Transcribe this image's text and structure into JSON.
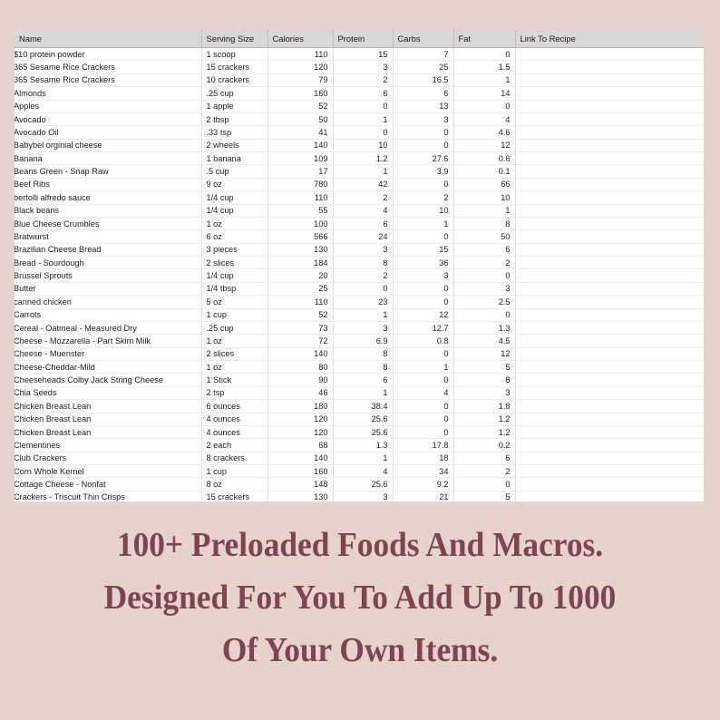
{
  "theme": {
    "background": "#e8d2cc",
    "headline_color": "#7d4552",
    "header_row_bg": "#d8d8d8",
    "cell_bg": "#ffffff",
    "grid_line": "#e0e0e0"
  },
  "spreadsheet": {
    "columns": [
      "Name",
      "Serving Size",
      "Calories",
      "Protein",
      "Carbs",
      "Fat",
      "Link To Recipe"
    ],
    "rows": [
      {
        "name": "$10 protein powder",
        "serving": "1 scoop",
        "calories": "110",
        "protein": "15",
        "carbs": "7",
        "fat": "0",
        "link": ""
      },
      {
        "name": "365 Sesame Rice Crackers",
        "serving": "15 crackers",
        "calories": "120",
        "protein": "3",
        "carbs": "25",
        "fat": "1.5",
        "link": ""
      },
      {
        "name": "365 Sesame Rice Crackers",
        "serving": "10 crackers",
        "calories": "79",
        "protein": "2",
        "carbs": "16.5",
        "fat": "1",
        "link": ""
      },
      {
        "name": "Almonds",
        "serving": ".25 cup",
        "calories": "160",
        "protein": "6",
        "carbs": "6",
        "fat": "14",
        "link": ""
      },
      {
        "name": "Apples",
        "serving": "1 apple",
        "calories": "52",
        "protein": "0",
        "carbs": "13",
        "fat": "0",
        "link": ""
      },
      {
        "name": "Avocado",
        "serving": "2 tbsp",
        "calories": "50",
        "protein": "1",
        "carbs": "3",
        "fat": "4",
        "link": ""
      },
      {
        "name": "Avocado Oil",
        "serving": ".33 tsp",
        "calories": "41",
        "protein": "0",
        "carbs": "0",
        "fat": "4.6",
        "link": ""
      },
      {
        "name": "Babybel orginial cheese",
        "serving": "2 wheels",
        "calories": "140",
        "protein": "10",
        "carbs": "0",
        "fat": "12",
        "link": ""
      },
      {
        "name": "Banana",
        "serving": "1 banana",
        "calories": "109",
        "protein": "1.2",
        "carbs": "27.6",
        "fat": "0.6",
        "link": ""
      },
      {
        "name": "Beans Green - Snap Raw",
        "serving": ".5 cup",
        "calories": "17",
        "protein": "1",
        "carbs": "3.9",
        "fat": "0.1",
        "link": ""
      },
      {
        "name": "Beef Ribs",
        "serving": "9 oz",
        "calories": "780",
        "protein": "42",
        "carbs": "0",
        "fat": "66",
        "link": ""
      },
      {
        "name": "bertolli alfredo sauce",
        "serving": "1/4 cup",
        "calories": "110",
        "protein": "2",
        "carbs": "2",
        "fat": "10",
        "link": ""
      },
      {
        "name": "Black beans",
        "serving": "1/4 cup",
        "calories": "55",
        "protein": "4",
        "carbs": "10",
        "fat": "1",
        "link": ""
      },
      {
        "name": "Blue Cheese Crumbles",
        "serving": "1 oz",
        "calories": "100",
        "protein": "6",
        "carbs": "1",
        "fat": "8",
        "link": ""
      },
      {
        "name": "Bratwurst",
        "serving": "6 oz",
        "calories": "566",
        "protein": "24",
        "carbs": "0",
        "fat": "50",
        "link": ""
      },
      {
        "name": "Brazilian Cheese Bread",
        "serving": "3 pieces",
        "calories": "130",
        "protein": "3",
        "carbs": "15",
        "fat": "6",
        "link": ""
      },
      {
        "name": "Bread - Sourdough",
        "serving": "2 slices",
        "calories": "184",
        "protein": "8",
        "carbs": "36",
        "fat": "2",
        "link": ""
      },
      {
        "name": "Brussel Sprouts",
        "serving": "1/4 cup",
        "calories": "20",
        "protein": "2",
        "carbs": "3",
        "fat": "0",
        "link": ""
      },
      {
        "name": "Butter",
        "serving": "1/4 tbsp",
        "calories": "25",
        "protein": "0",
        "carbs": "0",
        "fat": "3",
        "link": ""
      },
      {
        "name": "canned chicken",
        "serving": "5 oz",
        "calories": "110",
        "protein": "23",
        "carbs": "0",
        "fat": "2.5",
        "link": ""
      },
      {
        "name": "Carrots",
        "serving": "1 cup",
        "calories": "52",
        "protein": "1",
        "carbs": "12",
        "fat": "0",
        "link": ""
      },
      {
        "name": "Cereal - Oatmeal - Measured Dry",
        "serving": ".25 cup",
        "calories": "73",
        "protein": "3",
        "carbs": "12.7",
        "fat": "1.3",
        "link": ""
      },
      {
        "name": "Cheese - Mozzarella - Part Skim Milk",
        "serving": "1 oz",
        "calories": "72",
        "protein": "6.9",
        "carbs": "0.8",
        "fat": "4.5",
        "link": ""
      },
      {
        "name": "Cheese - Muenster",
        "serving": "2 slices",
        "calories": "140",
        "protein": "8",
        "carbs": "0",
        "fat": "12",
        "link": ""
      },
      {
        "name": "Cheese-Cheddar-Mild",
        "serving": "1 oz",
        "calories": "80",
        "protein": "8",
        "carbs": "1",
        "fat": "5",
        "link": ""
      },
      {
        "name": "Cheeseheads Colby Jack String Cheese",
        "serving": "1 Stick",
        "calories": "90",
        "protein": "6",
        "carbs": "0",
        "fat": "8",
        "link": ""
      },
      {
        "name": "Chia Seeds",
        "serving": "2 tsp",
        "calories": "46",
        "protein": "1",
        "carbs": "4",
        "fat": "3",
        "link": ""
      },
      {
        "name": "Chicken Breast Lean",
        "serving": "6 ounces",
        "calories": "180",
        "protein": "38.4",
        "carbs": "0",
        "fat": "1.8",
        "link": ""
      },
      {
        "name": "Chicken Breast Lean",
        "serving": "4 ounces",
        "calories": "120",
        "protein": "25.6",
        "carbs": "0",
        "fat": "1.2",
        "link": ""
      },
      {
        "name": "Chicken Breast Lean",
        "serving": "4 ounces",
        "calories": "120",
        "protein": "25.6",
        "carbs": "0",
        "fat": "1.2",
        "link": ""
      },
      {
        "name": "Clementines",
        "serving": "2 each",
        "calories": "68",
        "protein": "1.3",
        "carbs": "17.8",
        "fat": "0.2",
        "link": ""
      },
      {
        "name": "Club Crackers",
        "serving": "8 crackers",
        "calories": "140",
        "protein": "1",
        "carbs": "18",
        "fat": "6",
        "link": ""
      },
      {
        "name": "Corn Whole Kernel",
        "serving": "1 cup",
        "calories": "160",
        "protein": "4",
        "carbs": "34",
        "fat": "2",
        "link": ""
      },
      {
        "name": "Cottage Cheese - Nonfat",
        "serving": "8 oz",
        "calories": "148",
        "protein": "25.6",
        "carbs": "9.2",
        "fat": "0",
        "link": ""
      },
      {
        "name": "Crackers - Triscuit Thin Crisps",
        "serving": "15 crackers",
        "calories": "130",
        "protein": "3",
        "carbs": "21",
        "fat": "5",
        "link": ""
      }
    ]
  },
  "headline": {
    "line1": "100+ Preloaded Foods And Macros.",
    "line2": "Designed For You To Add Up To 1000",
    "line3": "Of Your Own Items."
  }
}
